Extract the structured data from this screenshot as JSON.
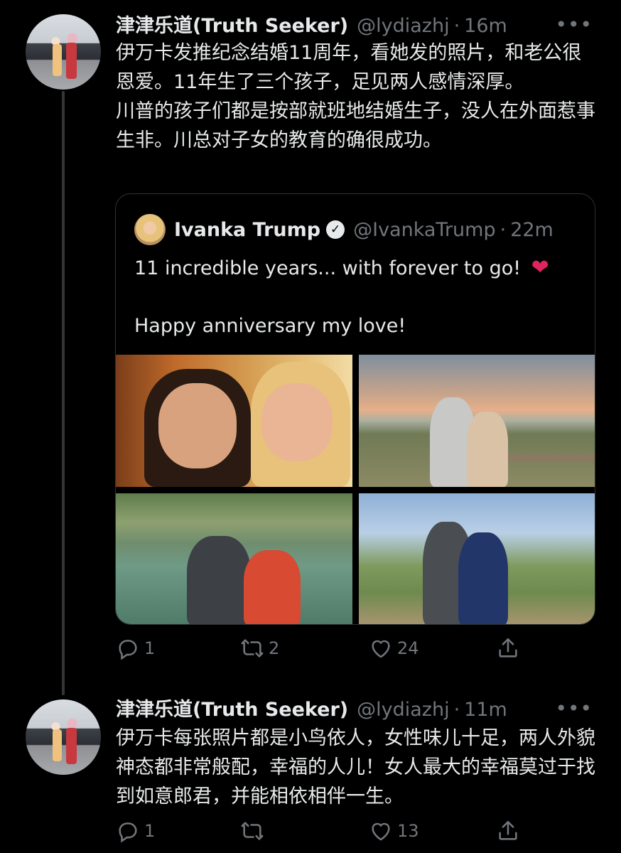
{
  "tweets": [
    {
      "display_name": "津津乐道(Truth Seeker)",
      "handle": "@lydiazhj",
      "separator": "·",
      "time": "16m",
      "more": "•••",
      "paragraphs": [
        "伊万卡发推纪念结婚11周年，看她发的照片，和老公很恩爱。11年生了三个孩子，足见两人感情深厚。",
        "川普的孩子们都是按部就班地结婚生子，没人在外面惹事生非。川总对子女的教育的确很成功。"
      ],
      "quote": {
        "display_name": "Ivanka Trump",
        "verified_mark": "✓",
        "handle": "@IvankaTrump",
        "separator": "·",
        "time": "22m",
        "line1": "11 incredible years... with forever to go!",
        "emoji": "❤",
        "line2": "Happy anniversary my love!"
      },
      "actions": {
        "reply_count": "1",
        "retweet_count": "2",
        "like_count": "24",
        "share_count": ""
      }
    },
    {
      "display_name": "津津乐道(Truth Seeker)",
      "handle": "@lydiazhj",
      "separator": "·",
      "time": "11m",
      "more": "•••",
      "paragraphs": [
        "伊万卡每张照片都是小鸟依人，女性味儿十足，两人外貌神态都非常般配，幸福的人儿！女人最大的幸福莫过于找到如意郎君，并能相依相伴一生。"
      ],
      "actions": {
        "reply_count": "1",
        "retweet_count": "",
        "like_count": "13",
        "share_count": ""
      }
    }
  ],
  "icons": {
    "reply": "reply-icon",
    "retweet": "retweet-icon",
    "like": "heart-icon",
    "share": "share-icon",
    "verified": "verified-badge-icon"
  },
  "colors": {
    "background": "#000000",
    "text_primary": "#e7e9ea",
    "text_secondary": "#71767b",
    "border": "#2f3336",
    "heart_emoji": "#e0245e"
  }
}
